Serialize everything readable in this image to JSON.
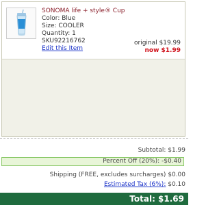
{
  "item": {
    "name": "SONOMA life + style® Cup",
    "color": "Color: Blue",
    "size": "Size: COOLER",
    "quantity": "Quantity: 1",
    "sku": "SKU92216762",
    "edit_label": "Edit this Item",
    "original_price": "original $19.99",
    "now_price": "now $1.99",
    "thumbnail_icon": "tumbler-cup-icon"
  },
  "summary": {
    "subtotal": "Subtotal: $1.99",
    "percent_off": "Percent Off (20%): -$0.40",
    "shipping": "Shipping (FREE, excludes surcharges) $0.00",
    "tax_link": "Estimated Tax (6%):",
    "tax_value": " $0.10",
    "total": "Total: $1.69"
  },
  "colors": {
    "item_name": "#8a1f2a",
    "sale_price": "#d0141d",
    "link": "#1a32c8",
    "discount_bg": "#e8f5d8",
    "discount_border": "#8cc96a",
    "total_bar": "#1f6b3e"
  }
}
